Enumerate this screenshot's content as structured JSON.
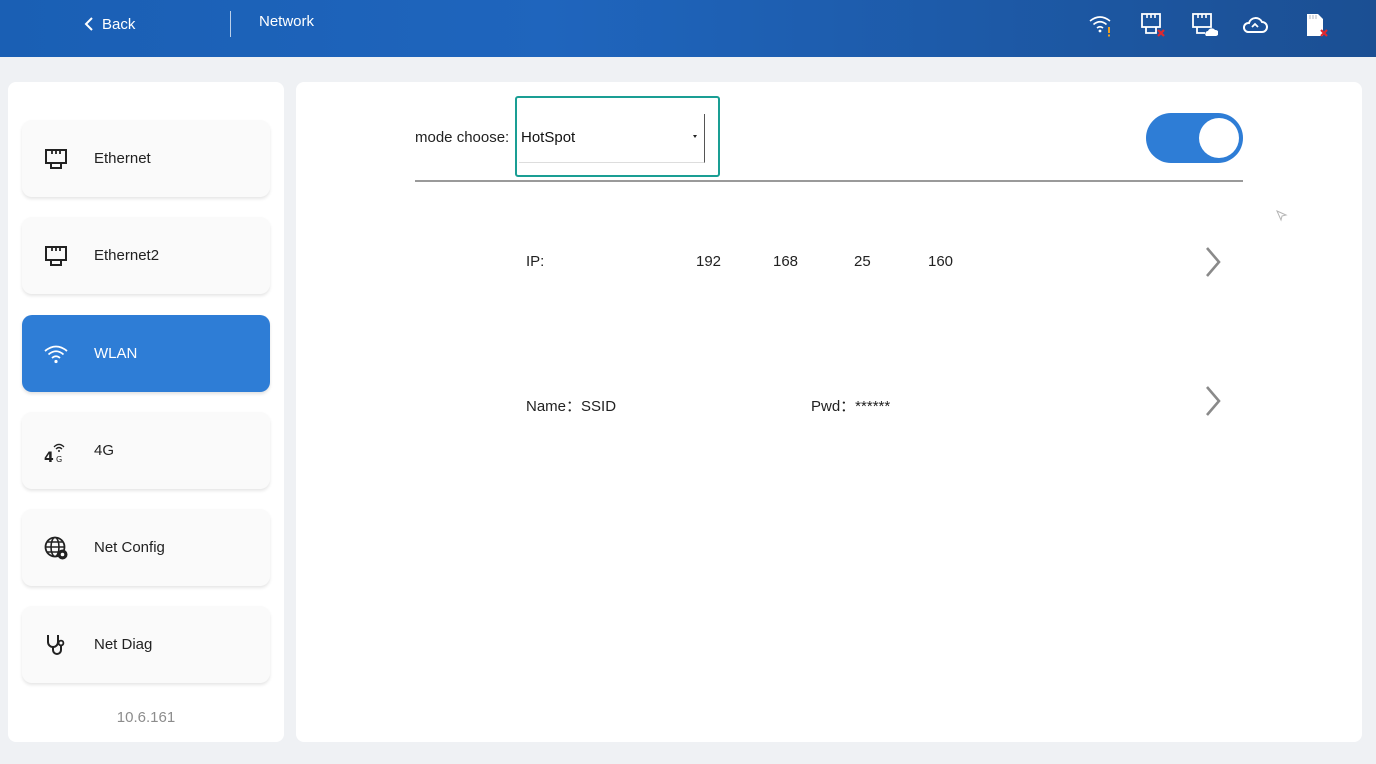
{
  "header": {
    "back_label": "Back",
    "title": "Network",
    "status_icons": [
      "wifi-warning-icon",
      "ethernet-error-icon",
      "ethernet-cloud-icon",
      "cloud-link-icon",
      "sd-card-error-icon"
    ],
    "colors": {
      "bar": "#1f65bd",
      "warning": "#f0a020",
      "error": "#e0282e"
    }
  },
  "sidebar": {
    "items": [
      {
        "label": "Ethernet",
        "icon": "ethernet-icon",
        "active": false
      },
      {
        "label": "Ethernet2",
        "icon": "ethernet-icon",
        "active": false
      },
      {
        "label": "WLAN",
        "icon": "wifi-icon",
        "active": true
      },
      {
        "label": "4G",
        "icon": "4g-signal-icon",
        "active": false
      },
      {
        "label": "Net Config",
        "icon": "globe-gear-icon",
        "active": false
      },
      {
        "label": "Net Diag",
        "icon": "stethoscope-icon",
        "active": false
      }
    ],
    "version": "10.6.161",
    "colors": {
      "active": "#2e7dd6"
    }
  },
  "main": {
    "mode_label": "mode choose:",
    "mode_value": "HotSpot",
    "toggle_on": true,
    "ip_label": "IP:",
    "ip_parts": [
      "192",
      "168",
      "25",
      "160"
    ],
    "name_label": "Name：SSID",
    "pwd_label": "Pwd：******",
    "colors": {
      "highlight": "#1a9e94",
      "toggle": "#2e7dd6"
    }
  }
}
